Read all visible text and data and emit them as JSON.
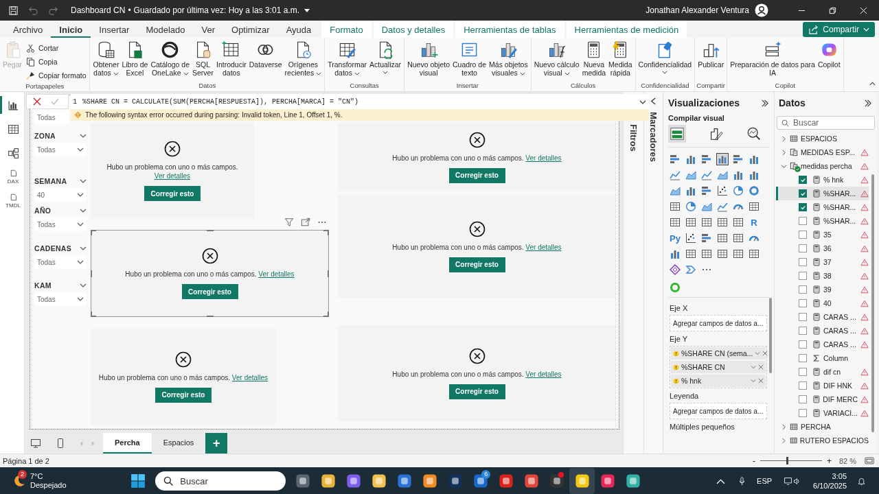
{
  "title_bar": {
    "document": "Dashboard CN",
    "separator": "•",
    "saved": "Guardado por última vez: Hoy a las 3:01 a.m.",
    "user": "Jonathan Alexander Ventura",
    "undo_disabled": true,
    "redo_disabled": true
  },
  "menu_tabs": [
    {
      "label": "Archivo",
      "selected": false,
      "contextual": false
    },
    {
      "label": "Inicio",
      "selected": true,
      "contextual": false
    },
    {
      "label": "Insertar",
      "selected": false,
      "contextual": false
    },
    {
      "label": "Modelado",
      "selected": false,
      "contextual": false
    },
    {
      "label": "Ver",
      "selected": false,
      "contextual": false
    },
    {
      "label": "Optimizar",
      "selected": false,
      "contextual": false
    },
    {
      "label": "Ayuda",
      "selected": false,
      "contextual": false
    },
    {
      "label": "Formato",
      "selected": false,
      "contextual": true
    },
    {
      "label": "Datos y detalles",
      "selected": false,
      "contextual": true
    },
    {
      "label": "Herramientas de tablas",
      "selected": false,
      "contextual": true
    },
    {
      "label": "Herramientas de medición",
      "selected": false,
      "contextual": true
    }
  ],
  "share_button": "Compartir",
  "ribbon_groups": [
    {
      "caption": "Portapapeles",
      "buttons": [
        {
          "label": "Pegar",
          "kind": "large",
          "disabled": true,
          "dropdown": false
        },
        {
          "label": "Cortar",
          "kind": "small",
          "disabled": false
        },
        {
          "label": "Copia",
          "kind": "small",
          "disabled": false
        },
        {
          "label": "Copiar formato",
          "kind": "small",
          "disabled": false
        }
      ]
    },
    {
      "caption": "Datos",
      "buttons": [
        {
          "label": "Obtener\ndatos",
          "kind": "large",
          "disabled": false,
          "dropdown": true
        },
        {
          "label": "Libro de\nExcel",
          "kind": "large",
          "disabled": false,
          "dropdown": false
        },
        {
          "label": "Catálogo de\nOneLake",
          "kind": "large",
          "disabled": false,
          "dropdown": true
        },
        {
          "label": "SQL\nServer",
          "kind": "large",
          "disabled": false,
          "dropdown": false
        },
        {
          "label": "Introducir\ndatos",
          "kind": "large",
          "disabled": false,
          "dropdown": false
        },
        {
          "label": "Dataverse",
          "kind": "large",
          "disabled": false,
          "dropdown": false
        },
        {
          "label": "Orígenes\nrecientes",
          "kind": "large",
          "disabled": false,
          "dropdown": true
        }
      ]
    },
    {
      "caption": "Consultas",
      "buttons": [
        {
          "label": "Transformar\ndatos",
          "kind": "large",
          "disabled": false,
          "dropdown": true
        },
        {
          "label": "Actualizar",
          "kind": "large",
          "disabled": false,
          "dropdown": true
        }
      ]
    },
    {
      "caption": "Insertar",
      "buttons": [
        {
          "label": "Nuevo objeto\nvisual",
          "kind": "large",
          "disabled": false,
          "dropdown": false
        },
        {
          "label": "Cuadro de\ntexto",
          "kind": "large",
          "disabled": false,
          "dropdown": false
        },
        {
          "label": "Más objetos\nvisuales",
          "kind": "large",
          "disabled": false,
          "dropdown": true
        }
      ]
    },
    {
      "caption": "Cálculos",
      "buttons": [
        {
          "label": "Nuevo cálculo\nvisual",
          "kind": "large",
          "disabled": false,
          "dropdown": true
        },
        {
          "label": "Nueva\nmedida",
          "kind": "large",
          "disabled": false,
          "dropdown": false
        },
        {
          "label": "Medida\nrápida",
          "kind": "large",
          "disabled": false,
          "dropdown": false
        }
      ]
    },
    {
      "caption": "Confidencialidad",
      "buttons": [
        {
          "label": "Confidencialidad",
          "kind": "large",
          "disabled": false,
          "dropdown": true
        }
      ]
    },
    {
      "caption": "Compartir",
      "buttons": [
        {
          "label": "Publicar",
          "kind": "large",
          "disabled": false,
          "dropdown": false
        }
      ]
    },
    {
      "caption": "Copilot",
      "buttons": [
        {
          "label": "Preparación de datos para\nIA",
          "kind": "large",
          "disabled": false,
          "dropdown": false
        },
        {
          "label": "Copilot",
          "kind": "large",
          "disabled": false,
          "dropdown": false
        }
      ]
    }
  ],
  "left_rail": [
    {
      "selected": true
    },
    {
      "selected": false
    },
    {
      "selected": false
    },
    {
      "selected": false,
      "label": "DAX"
    },
    {
      "selected": false,
      "label": "TMDL"
    }
  ],
  "formula_bar": {
    "line_number": "1",
    "code": "%SHARE CN = CALCULATE(SUM(PERCHA[RESPUESTA]), PERCHA[MARCA] = \"CN\")",
    "error": "The following syntax error occurred during parsing: Invalid token, Line 1, Offset 1, %."
  },
  "slicers": [
    {
      "value": "Todas"
    },
    {
      "title": "ZONA",
      "value": "Todas"
    },
    {
      "title": "SEMANA",
      "value": "40"
    },
    {
      "title": "AÑO",
      "value": "Todas"
    },
    {
      "title": "CADENAS",
      "value": "Todas"
    },
    {
      "title": "KAM",
      "value": "Todas"
    }
  ],
  "visuals": [
    {
      "message": "Hubo un problema con uno o más campos.",
      "link": "Ver detalles",
      "button": "Corregir esto",
      "selected": false
    },
    {
      "message": "Hubo un problema con uno o más campos.",
      "link": "Ver detalles",
      "button": "Corregir esto",
      "selected": false
    },
    {
      "message": "Hubo un problema con uno o más campos.",
      "link": "Ver detalles",
      "button": "Corregir esto",
      "selected": true
    },
    {
      "message": "Hubo un problema con uno o más campos.",
      "link": "Ver detalles",
      "button": "Corregir esto",
      "selected": false
    },
    {
      "message": "Hubo un problema con uno o más campos.",
      "link": "Ver detalles",
      "button": "Corregir esto",
      "selected": false
    },
    {
      "message": "Hubo un problema con uno o más campos.",
      "link": "Ver detalles",
      "button": "Corregir esto",
      "selected": false
    }
  ],
  "side_tabs": {
    "filters": "Filtros",
    "bookmarks": "Marcadores"
  },
  "visualizations": {
    "title": "Visualizaciones",
    "subtitle": "Compilar visual",
    "modes": [
      {
        "selected": true
      },
      {
        "selected": false
      },
      {
        "selected": false
      }
    ],
    "types": [
      {
        "selected": false
      },
      {
        "selected": false
      },
      {
        "selected": false
      },
      {
        "selected": true
      },
      {
        "selected": false
      },
      {
        "selected": false
      },
      {
        "selected": false
      },
      {
        "selected": false
      },
      {
        "selected": false
      },
      {
        "selected": false
      },
      {
        "selected": false
      },
      {
        "selected": false
      },
      {
        "selected": false
      },
      {
        "selected": false
      },
      {
        "selected": false
      },
      {
        "selected": false
      },
      {
        "selected": false
      },
      {
        "selected": false
      },
      {
        "selected": false
      },
      {
        "selected": false
      },
      {
        "selected": false
      },
      {
        "selected": false
      },
      {
        "selected": false
      },
      {
        "selected": false
      },
      {
        "selected": false
      },
      {
        "selected": false
      },
      {
        "selected": false
      },
      {
        "selected": false
      },
      {
        "selected": false
      },
      {
        "selected": false,
        "label": "R"
      },
      {
        "selected": false,
        "label": "Py"
      },
      {
        "selected": false
      },
      {
        "selected": false
      },
      {
        "selected": false
      },
      {
        "selected": false
      },
      {
        "selected": false
      },
      {
        "selected": false
      },
      {
        "selected": false
      },
      {
        "selected": false
      },
      {
        "selected": false
      },
      {
        "selected": false
      },
      {
        "selected": false
      },
      {
        "selected": false
      },
      {
        "selected": false
      }
    ],
    "wells": [
      {
        "label": "Eje X",
        "placeholder": "Agregar campos de datos a..."
      },
      {
        "label": "Eje Y",
        "fields": [
          {
            "name": "%SHARE CN (sema...",
            "warning": true
          },
          {
            "name": "%SHARE CN",
            "warning": true
          },
          {
            "name": "% hnk",
            "warning": true
          }
        ]
      },
      {
        "label": "Leyenda",
        "placeholder": "Agregar campos de datos a..."
      },
      {
        "label": "Múltiples pequeños"
      }
    ]
  },
  "data_pane": {
    "title": "Datos",
    "search_placeholder": "Buscar",
    "tables": [
      {
        "name": "ESPACIOS",
        "kind": "table",
        "expanded": false,
        "warning": false
      },
      {
        "name": "MEDIDAS ESP...",
        "kind": "measure_table",
        "expanded": false,
        "warning": true
      },
      {
        "name": "medidas percha",
        "kind": "measure_table",
        "expanded": true,
        "warning": true,
        "children": [
          {
            "name": "% hnk",
            "kind": "measure",
            "checked": true,
            "selected": false,
            "warning": true
          },
          {
            "name": "%SHAR...",
            "kind": "measure",
            "checked": true,
            "selected": true,
            "warning": true
          },
          {
            "name": "%SHAR...",
            "kind": "measure",
            "checked": true,
            "selected": false,
            "warning": true
          },
          {
            "name": "%SHAR...",
            "kind": "measure",
            "checked": false,
            "selected": false,
            "warning": true
          },
          {
            "name": "35",
            "kind": "measure",
            "checked": false,
            "selected": false,
            "warning": true
          },
          {
            "name": "36",
            "kind": "measure",
            "checked": false,
            "selected": false,
            "warning": true
          },
          {
            "name": "37",
            "kind": "measure",
            "checked": false,
            "selected": false,
            "warning": true
          },
          {
            "name": "38",
            "kind": "measure",
            "checked": false,
            "selected": false,
            "warning": true
          },
          {
            "name": "39",
            "kind": "measure",
            "checked": false,
            "selected": false,
            "warning": true
          },
          {
            "name": "40",
            "kind": "measure",
            "checked": false,
            "selected": false,
            "warning": true
          },
          {
            "name": "CARAS ...",
            "kind": "measure",
            "checked": false,
            "selected": false,
            "warning": true
          },
          {
            "name": "CARAS ...",
            "kind": "measure",
            "checked": false,
            "selected": false,
            "warning": true
          },
          {
            "name": "CARAS ...",
            "kind": "measure",
            "checked": false,
            "selected": false,
            "warning": true
          },
          {
            "name": "Column",
            "kind": "column",
            "checked": false,
            "selected": false,
            "warning": false
          },
          {
            "name": "dif cn",
            "kind": "measure",
            "checked": false,
            "selected": false,
            "warning": true
          },
          {
            "name": "DIF HNK",
            "kind": "measure",
            "checked": false,
            "selected": false,
            "warning": true
          },
          {
            "name": "DIF MERC",
            "kind": "measure",
            "checked": false,
            "selected": false,
            "warning": true
          },
          {
            "name": "VARIACI...",
            "kind": "measure",
            "checked": false,
            "selected": false,
            "warning": true
          }
        ]
      },
      {
        "name": "PERCHA",
        "kind": "table",
        "expanded": false,
        "warning": false
      },
      {
        "name": "RUTERO ESPACIOS",
        "kind": "table",
        "expanded": false,
        "warning": false
      }
    ]
  },
  "page_tabs": [
    {
      "label": "Percha",
      "selected": true
    },
    {
      "label": "Espacios",
      "selected": false
    }
  ],
  "add_page": "+",
  "status_bar": {
    "page": "Página 1 de 2",
    "zoom_minus": "-",
    "zoom_plus": "+",
    "zoom": "82 %",
    "zoom_slider": {
      "level": 0.42
    }
  },
  "taskbar": {
    "weather_badge": "2",
    "temperature": "7°C",
    "condition": "Despejado",
    "search_placeholder": "Buscar",
    "language": "ESP",
    "time": "3:05",
    "date": "6/10/2025",
    "apps": [
      {
        "active": false,
        "notification": false
      },
      {
        "active": false,
        "notification": false
      },
      {
        "active": false,
        "notification": false
      },
      {
        "active": false,
        "notification": false
      },
      {
        "active": false,
        "notification": false
      },
      {
        "active": false,
        "notification": false
      },
      {
        "active": false,
        "notification": false
      },
      {
        "active": false,
        "notification": false,
        "badge": "6"
      },
      {
        "active": false,
        "notification": false
      },
      {
        "active": false,
        "notification": false
      },
      {
        "active": false,
        "notification": true
      },
      {
        "active": true,
        "notification": false
      },
      {
        "active": false,
        "notification": false
      },
      {
        "active": false,
        "notification": false
      }
    ]
  }
}
